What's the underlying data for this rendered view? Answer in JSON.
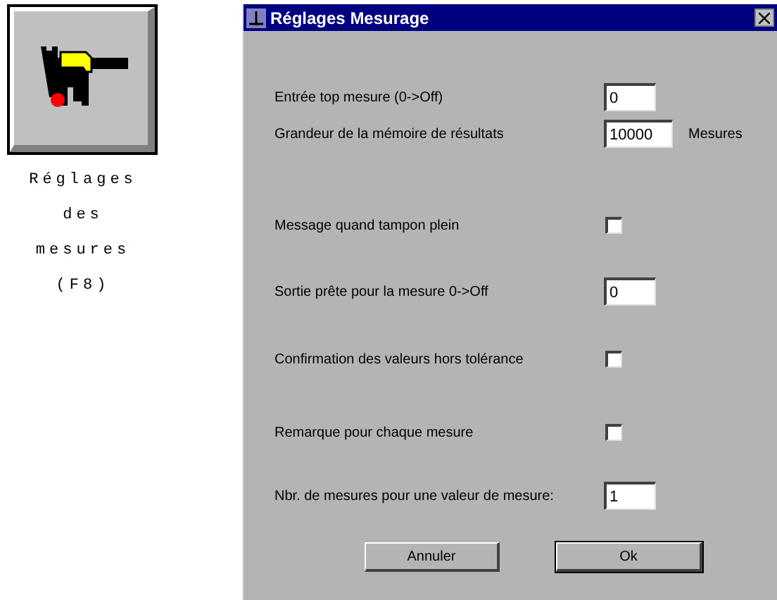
{
  "shortcut": {
    "caption": "Réglages des mesures (F8)"
  },
  "dialog": {
    "title": "Réglages Mesurage",
    "rows": [
      {
        "kind": "field",
        "label": "Entrée top mesure (0->Off)",
        "value": "0"
      },
      {
        "kind": "field",
        "label": "Grandeur de la mémoire de résultats",
        "value": "10000",
        "unit": "Mesures"
      },
      {
        "kind": "checkbox",
        "label": "Message quand tampon plein",
        "checked": false
      },
      {
        "kind": "field",
        "label": "Sortie prête pour la mesure 0->Off",
        "value": "0"
      },
      {
        "kind": "checkbox",
        "label": "Confirmation des valeurs hors tolérance",
        "checked": false
      },
      {
        "kind": "checkbox",
        "label": "Remarque pour chaque mesure",
        "checked": false
      },
      {
        "kind": "field",
        "label": "Nbr. de mesures pour une valeur de mesure:",
        "value": "1"
      }
    ],
    "buttons": [
      {
        "label": "Annuler",
        "default": false
      },
      {
        "label": "Ok",
        "default": true
      }
    ]
  }
}
